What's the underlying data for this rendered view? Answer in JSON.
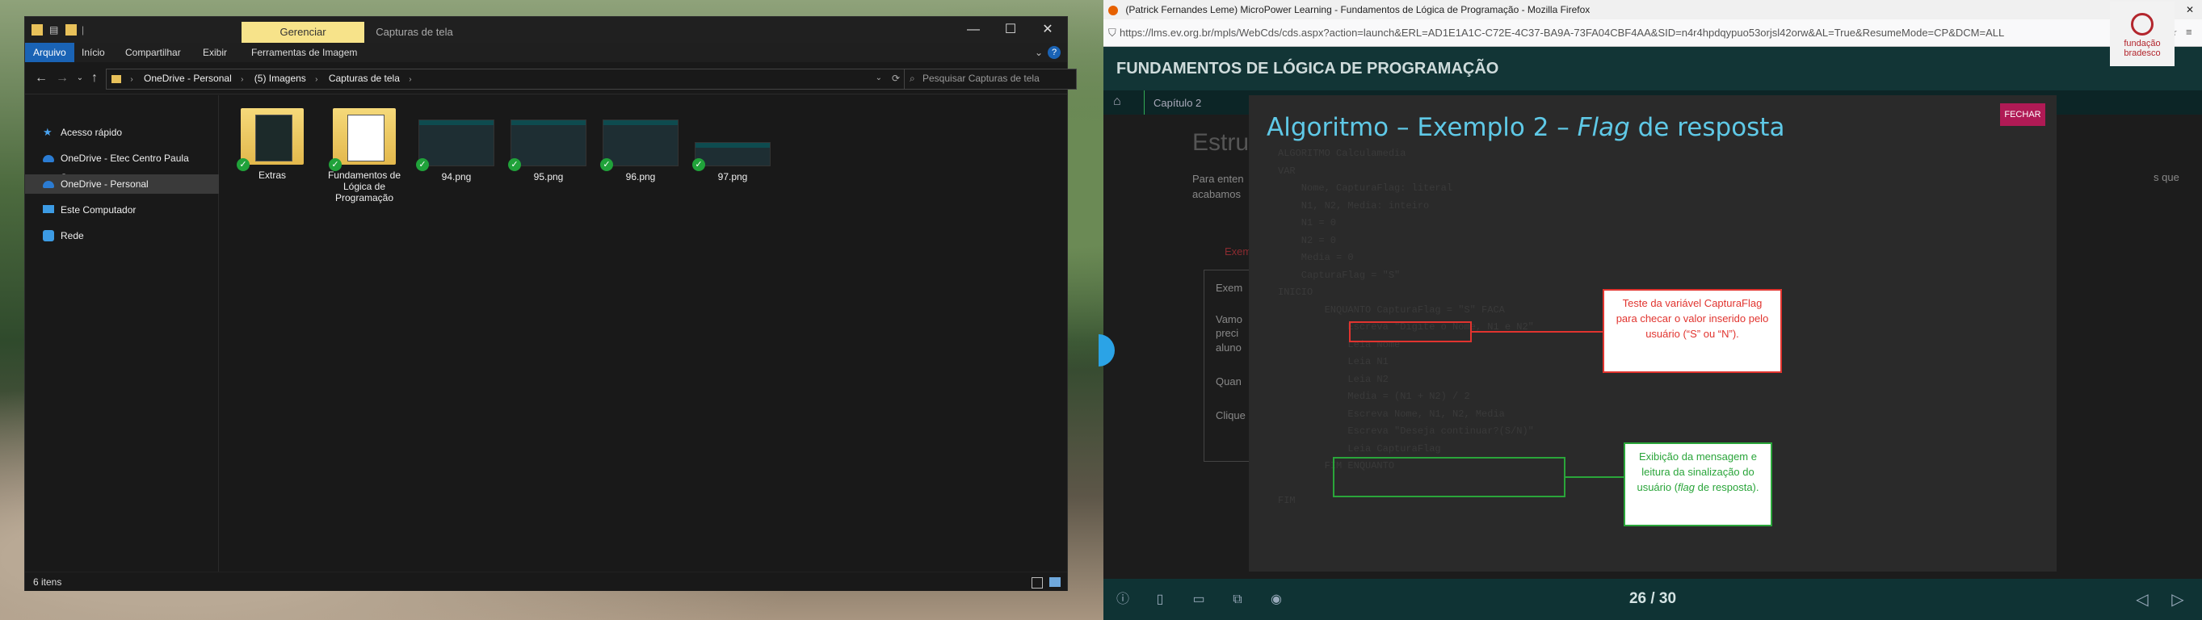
{
  "explorer": {
    "context_tab": "Gerenciar",
    "window_title": "Capturas de tela",
    "ribbon_tabs": [
      "Arquivo",
      "Início",
      "Compartilhar",
      "Exibir",
      "Ferramentas de Imagem"
    ],
    "breadcrumb": [
      "OneDrive - Personal",
      "(5) Imagens",
      "Capturas de tela"
    ],
    "search_placeholder": "Pesquisar Capturas de tela",
    "nav_items": [
      "Acesso rápido",
      "OneDrive - Etec Centro Paula Souza",
      "OneDrive - Personal",
      "Este Computador",
      "Rede"
    ],
    "files": [
      {
        "name": "Extras",
        "type": "folder"
      },
      {
        "name": "Fundamentos de Lógica de Programação",
        "type": "folder"
      },
      {
        "name": "94.png",
        "type": "png"
      },
      {
        "name": "95.png",
        "type": "png"
      },
      {
        "name": "96.png",
        "type": "png"
      },
      {
        "name": "97.png",
        "type": "png"
      }
    ],
    "status": "6 itens"
  },
  "firefox": {
    "window_title": "(Patrick Fernandes Leme) MicroPower Learning - Fundamentos de Lógica de Programação - Mozilla Firefox",
    "url": "https://lms.ev.org.br/mpls/WebCds/cds.aspx?action=launch&ERL=AD1E1A1C-C72E-4C37-BA9A-73FA04CBF4AA&SID=n4r4hpdqypuo53orjsl42orw&AL=True&ResumeMode=CP&DCM=ALL"
  },
  "course": {
    "header_title": "FUNDAMENTOS DE LÓGICA DE PROGRAMAÇÃO",
    "logo_text": "fundação bradesco",
    "breadcrumb": "Capítulo 2",
    "bg_heading": "Estru",
    "bg_paragraph": "Para enten acabamos",
    "bg_side_fragment": "s que",
    "bg_tab": "Exem",
    "bg_card_title": "Exem",
    "bg_card_lines": [
      "Vamo",
      "preci",
      "aluno",
      "Quan",
      "Clique"
    ],
    "page_indicator": "26 / 30"
  },
  "modal": {
    "title_prefix": "Algoritmo – Exemplo 2 – ",
    "title_italic": "Flag",
    "title_suffix": " de resposta",
    "close_label": "FECHAR",
    "code": "ALGORITMO Calculamedia\nVAR\n    Nome, CapturaFlag: literal\n    N1, N2, Media: inteiro\n    N1 = 0\n    N2 = 0\n    Media = 0\n    CapturaFlag = \"S\"\nINICIO\n        ENQUANTO CapturaFlag = \"S\" FACA\n            Escreva \"Digite o Nome, N1 e N2\"\n            Leia Nome\n            Leia N1\n            Leia N2\n            Media = (N1 + N2) / 2\n            Escreva Nome, N1, N2, Media\n            Escreva \"Deseja continuar?(S/N)\"\n            Leia CapturaFlag\n        FIM ENQUANTO\n\nFIM",
    "callout_red": "Teste da variável CapturaFlag para checar o valor inserido pelo usuário (“S” ou “N”).",
    "callout_green_prefix": "Exibição da mensagem e leitura da sinalização do usuário (",
    "callout_green_italic": "flag",
    "callout_green_suffix": " de resposta)."
  }
}
